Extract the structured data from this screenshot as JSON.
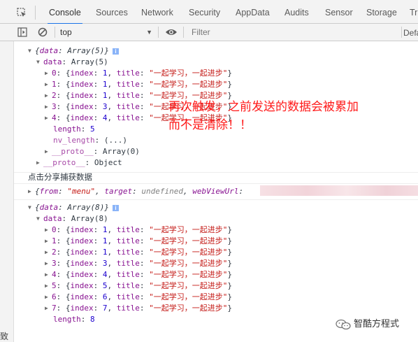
{
  "tabs": [
    {
      "label": "Console",
      "active": true
    },
    {
      "label": "Sources"
    },
    {
      "label": "Network"
    },
    {
      "label": "Security"
    },
    {
      "label": "AppData"
    },
    {
      "label": "Audits"
    },
    {
      "label": "Sensor"
    },
    {
      "label": "Storage"
    },
    {
      "label": "Tr"
    }
  ],
  "toolbar": {
    "context": "top",
    "filter_placeholder": "Filter",
    "levels_label": "Defa"
  },
  "gutter_label": "致",
  "log1": {
    "summary": {
      "prefix": "{",
      "key": "data",
      "sep": ": ",
      "value": "Array(5)",
      "suffix": "}"
    },
    "data_line": {
      "key": "data",
      "sep": ": ",
      "value": "Array(5)"
    },
    "items": [
      {
        "idx": "0",
        "index": "1",
        "title": "\"一起学习，一起进步\""
      },
      {
        "idx": "1",
        "index": "1",
        "title": "\"一起学习，一起进步\""
      },
      {
        "idx": "2",
        "index": "1",
        "title": "\"一起学习，一起进步\""
      },
      {
        "idx": "3",
        "index": "3",
        "title": "\"一起学习，一起进步\""
      },
      {
        "idx": "4",
        "index": "4",
        "title": "\"一起学习，一起进步\""
      }
    ],
    "length_key": "length",
    "length_value": "5",
    "nv_key": "nv_length",
    "nv_value": "(...)",
    "proto_inner_key": "__proto__",
    "proto_inner_value": "Array(0)",
    "proto_outer_key": "__proto__",
    "proto_outer_value": "Object"
  },
  "share_log": "点击分享捕获数据",
  "log2_summary": {
    "from_key": "from",
    "from_value": "\"menu\"",
    "target_key": "target",
    "target_value": "undefined",
    "url_key": "webViewUrl"
  },
  "log3": {
    "summary": {
      "prefix": "{",
      "key": "data",
      "sep": ": ",
      "value": "Array(8)",
      "suffix": "}"
    },
    "data_line": {
      "key": "data",
      "sep": ": ",
      "value": "Array(8)"
    },
    "items": [
      {
        "idx": "0",
        "index": "1",
        "title": "\"一起学习，一起进步\""
      },
      {
        "idx": "1",
        "index": "1",
        "title": "\"一起学习，一起进步\""
      },
      {
        "idx": "2",
        "index": "1",
        "title": "\"一起学习，一起进步\""
      },
      {
        "idx": "3",
        "index": "3",
        "title": "\"一起学习，一起进步\""
      },
      {
        "idx": "4",
        "index": "4",
        "title": "\"一起学习，一起进步\""
      },
      {
        "idx": "5",
        "index": "5",
        "title": "\"一起学习，一起进步\""
      },
      {
        "idx": "6",
        "index": "6",
        "title": "\"一起学习，一起进步\""
      },
      {
        "idx": "7",
        "index": "7",
        "title": "\"一起学习，一起进步\""
      }
    ],
    "length_key": "length",
    "length_value": "8"
  },
  "annotation": {
    "line1": "再次触发，之前发送的数据会被累加",
    "line2": "而不是清除！！"
  },
  "watermark": "智酷方程式",
  "colors": {
    "accent": "#1a73e8",
    "property_key": "#881391",
    "string": "#c41a16",
    "number": "#1c00cf",
    "annotation": "#ff1a1a"
  }
}
